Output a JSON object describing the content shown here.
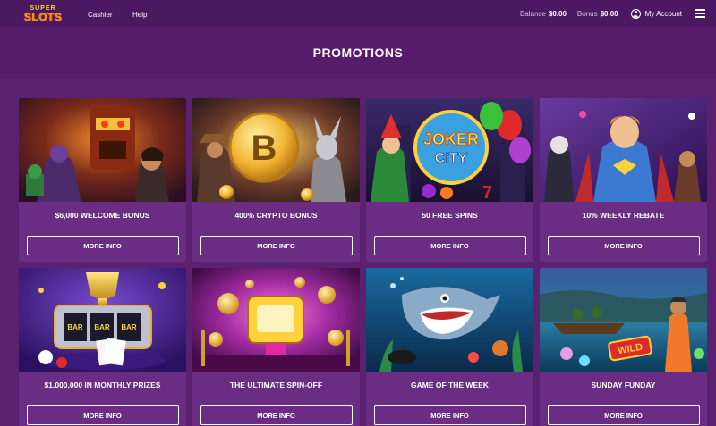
{
  "header": {
    "logo_top": "SUPER",
    "logo_bottom": "SLOTS",
    "nav": [
      "Cashier",
      "Help"
    ],
    "balance_label": "Balance",
    "balance_value": "$0.00",
    "bonus_label": "Bonus",
    "bonus_value": "$0.00",
    "account_label": "My Account"
  },
  "page": {
    "title": "PROMOTIONS"
  },
  "promotions": [
    {
      "title": "$6,000 WELCOME BONUS",
      "button": "MORE INFO"
    },
    {
      "title": "400% CRYPTO BONUS",
      "button": "MORE INFO"
    },
    {
      "title": "50 FREE SPINS",
      "button": "MORE INFO"
    },
    {
      "title": "10% WEEKLY REBATE",
      "button": "MORE INFO"
    },
    {
      "title": "$1,000,000 IN MONTHLY PRIZES",
      "button": "MORE INFO"
    },
    {
      "title": "THE ULTIMATE SPIN-OFF",
      "button": "MORE INFO"
    },
    {
      "title": "GAME OF THE WEEK",
      "button": "MORE INFO"
    },
    {
      "title": "SUNDAY FUNDAY",
      "button": "MORE INFO"
    }
  ],
  "image_texts": {
    "crypto_symbol": "B",
    "joker_logo_top": "JOKER",
    "joker_logo_bottom": "CITY",
    "reel_symbols": [
      "BAR",
      "BAR",
      "BAR"
    ],
    "wild_label": "WILD"
  }
}
